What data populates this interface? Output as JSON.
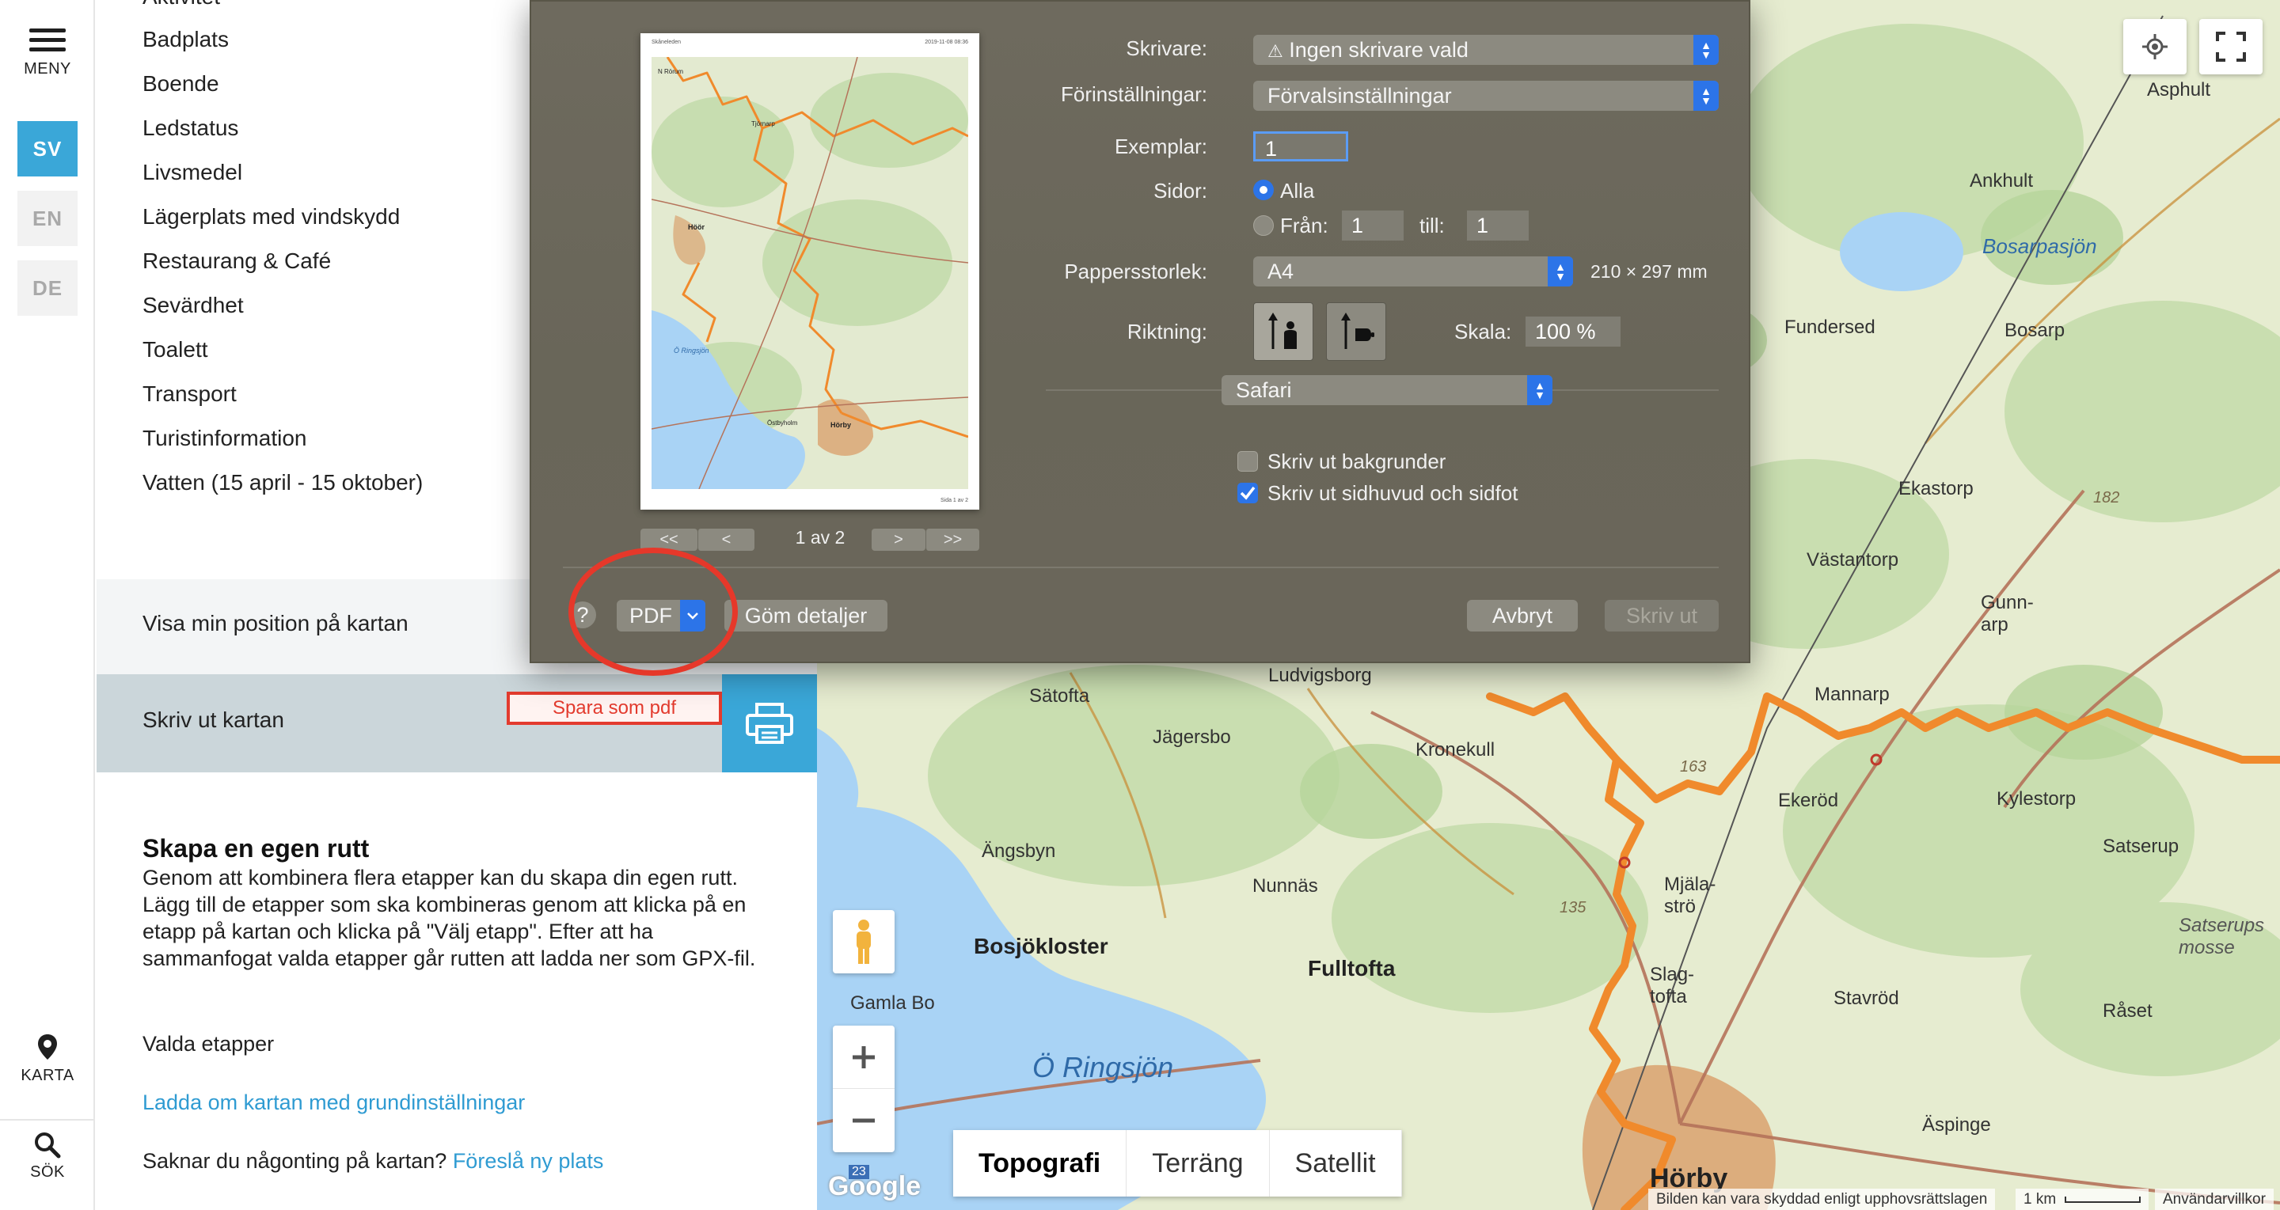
{
  "rail": {
    "menu_label": "MENY",
    "languages": [
      "SV",
      "EN",
      "DE"
    ],
    "active_language": "SV",
    "map_label": "KARTA",
    "search_label": "SÖK"
  },
  "panel": {
    "categories_partial_top": "Aktivitet",
    "categories": [
      "Badplats",
      "Boende",
      "Ledstatus",
      "Livsmedel",
      "Lägerplats med vindskydd",
      "Restaurang & Café",
      "Sevärdhet",
      "Toalett",
      "Transport",
      "Turistinformation",
      "Vatten (15 april - 15 oktober)"
    ],
    "show_position": "Visa min position på kartan",
    "print_map": "Skriv ut kartan",
    "annotation": "Spara som pdf",
    "route_title": "Skapa en egen rutt",
    "route_desc": "Genom att kombinera flera etapper kan du skapa din egen rutt. Lägg till de etapper som ska kombineras genom att klicka på en etapp på kartan och klicka på \"Välj etapp\". Efter att ha sammanfogat valda etapper går rutten att ladda ner som GPX-fil.",
    "selected_stages": "Valda etapper",
    "reload_link": "Ladda om kartan med grundinställningar",
    "missing_text": "Saknar du någonting på kartan?",
    "suggest_link": "Föreslå ny plats"
  },
  "dialog": {
    "printer_label": "Skrivare:",
    "printer_value": "Ingen skrivare vald",
    "presets_label": "Förinställningar:",
    "presets_value": "Förvalsinställningar",
    "copies_label": "Exemplar:",
    "copies_value": "1",
    "pages_label": "Sidor:",
    "pages_all": "Alla",
    "pages_from": "Från:",
    "pages_from_value": "1",
    "pages_to": "till:",
    "pages_to_value": "1",
    "paper_label": "Pappersstorlek:",
    "paper_value": "A4",
    "paper_dims": "210 × 297 mm",
    "orientation_label": "Riktning:",
    "scale_label": "Skala:",
    "scale_value": "100 %",
    "app_select": "Safari",
    "print_bg": "Skriv ut bakgrunder",
    "print_headers": "Skriv ut sidhuvud och sidfot",
    "print_bg_checked": false,
    "print_headers_checked": true,
    "page_indicator": "1 av 2",
    "help": "?",
    "pdf": "PDF",
    "hide_details": "Göm detaljer",
    "cancel": "Avbryt",
    "print": "Skriv ut",
    "preview_header_left": "Skåneleden",
    "preview_header_right": "2019-11-08 08:36",
    "preview_footer_right": "Sida 1 av 2",
    "preview_labels": [
      "Höör",
      "Ö Ringsjön",
      "Hörby",
      "Östbyholm",
      "N Rörum",
      "Tjörnarp"
    ]
  },
  "map": {
    "labels": [
      "Asphult",
      "Ankhult",
      "Bosarpasjön",
      "Fundersed",
      "Bosarp",
      "Ekastorp",
      "Västantorp",
      "Gunn-arp",
      "Ludvigsborg",
      "Sätofta",
      "Jägersbo",
      "Mannarp",
      "Kronekull",
      "Ekeröd",
      "Kylestorp",
      "Satserup",
      "Ängsbyn",
      "Nunnäs",
      "Mjäla-strö",
      "Bosjökloster",
      "Fulltofta",
      "Slag-tofta",
      "Stavröd",
      "Råset",
      "Satserups mosse",
      "Gamla Bo",
      "Ö Ringsjön",
      "Äspinge",
      "Hörby"
    ],
    "road_numbers": [
      "163",
      "135",
      "182",
      "23"
    ],
    "map_types": [
      "Topografi",
      "Terräng",
      "Satellit"
    ],
    "active_map_type": "Topografi",
    "attribution": "Bilden kan vara skyddad enligt upphovsrättslagen",
    "scale": "1 km",
    "terms": "Användarvillkor",
    "google": "Google",
    "colors": {
      "route": "#f08a2c",
      "water": "#a9d3f5",
      "accent": "#3aa7d8",
      "annotation": "#e33b2e"
    }
  }
}
